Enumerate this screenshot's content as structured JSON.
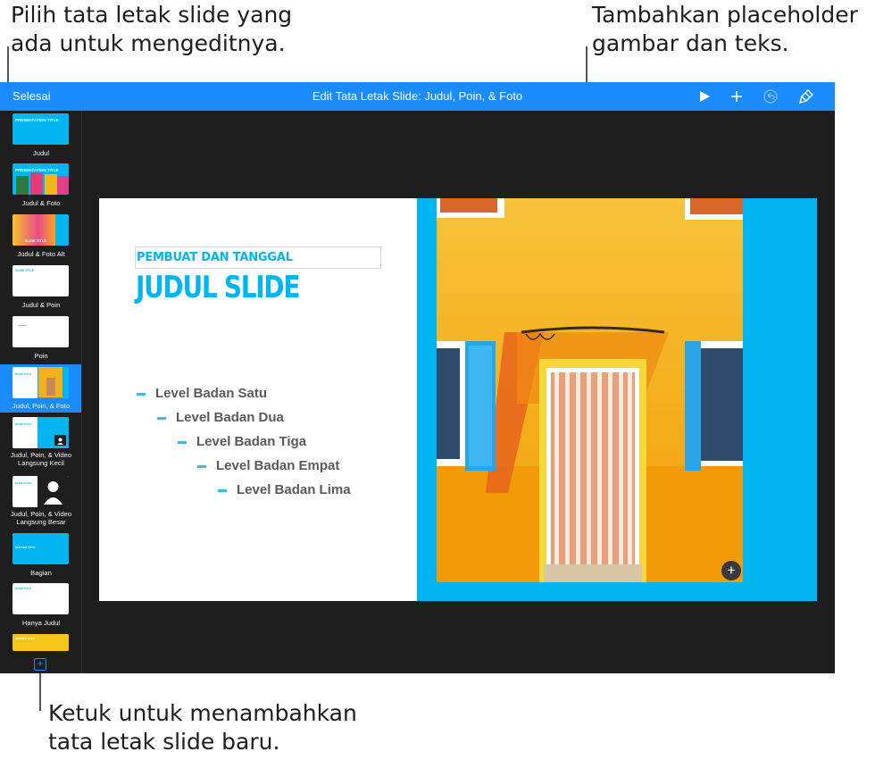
{
  "callouts": {
    "top_left": [
      "Pilih tata letak slide yang",
      "ada untuk mengeditnya."
    ],
    "top_right": [
      "Tambahkan placeholder",
      "gambar dan teks."
    ],
    "bottom": [
      "Ketuk untuk menambahkan",
      "tata letak slide baru."
    ]
  },
  "toolbar": {
    "done_label": "Selesai",
    "title": "Edit Tata Letak Slide: Judul, Poin, & Foto",
    "icons": [
      "play-icon",
      "plus-icon",
      "undo-icon",
      "paintbrush-icon"
    ]
  },
  "sidebar": {
    "items": [
      {
        "label": "Judul",
        "mini_text": "PRESENTATION TITLE"
      },
      {
        "label": "Judul & Foto",
        "mini_text": "PRESENTATION TITLE"
      },
      {
        "label": "Judul & Foto Alt",
        "mini_text": "SLIDE TITLE"
      },
      {
        "label": "Judul & Poin",
        "mini_text": "SLIDE TITLE"
      },
      {
        "label": "Poin",
        "mini_text": ""
      },
      {
        "label": "Judul, Poin, & Foto",
        "mini_text": "SLIDE TITLE",
        "selected": true
      },
      {
        "label": "Judul, Poin, & Video Langsung Kecil",
        "mini_text": "SLIDE TITLE"
      },
      {
        "label": "Judul, Poin, & Video Langsung Besar",
        "mini_text": "SLIDE TITLE"
      },
      {
        "label": "Bagian",
        "mini_text": "SECTION TITLE"
      },
      {
        "label": "Hanya Judul",
        "mini_text": "SLIDE TITLE"
      },
      {
        "label": "",
        "mini_text": "AGENDA TITLE"
      }
    ],
    "add_icon": "plus-square-icon"
  },
  "slide": {
    "subtitle": "PEMBUAT DAN TANGGAL",
    "title": "JUDUL SLIDE",
    "bullets": [
      "Level Badan Satu",
      "Level Badan Dua",
      "Level Badan Tiga",
      "Level Badan Empat",
      "Level Badan Lima"
    ],
    "add_media_icon": "plus-circle-icon"
  },
  "colors": {
    "accent": "#1a8cff",
    "slide_blue": "#00b5f0",
    "wall_yellow": "#f3b11e",
    "shutter_blue": "#2aa6e8"
  }
}
